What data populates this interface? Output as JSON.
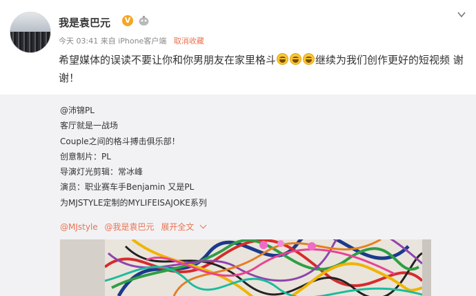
{
  "post": {
    "username": "我是袁巴元",
    "verified_mark": "V",
    "meta": {
      "time": "今天 03:41",
      "source": "来自 iPhone客户端",
      "favorite_action": "取消收藏"
    },
    "status_before_emoji": "希望媒体的误读不要让你和你男朋友在家里格斗",
    "emoji_name": "laughing-face-emoji",
    "status_after_emoji": "继续为我们创作更好的短视频 谢谢！"
  },
  "repost": {
    "lines": [
      "@沛锦PL",
      "客厅就是一战场",
      "Couple之间的格斗搏击俱乐部！",
      "创意制片：PL",
      "导演灯光剪辑：常冰峰",
      "演员：职业赛车手Benjamin 又是PL",
      "为MJSTYLE定制的MYLIFEISAJOKE系列"
    ],
    "mention_1": "@MJstyle",
    "mention_2": "@我是袁巴元",
    "expand_label": "展开全文"
  },
  "colors": {
    "accent": "#eb7350",
    "verified": "#f5a623",
    "repost_bg": "#f2f2f5"
  },
  "icons": [
    "badge-icon",
    "chevron-down-icon",
    "caret-down-icon"
  ]
}
